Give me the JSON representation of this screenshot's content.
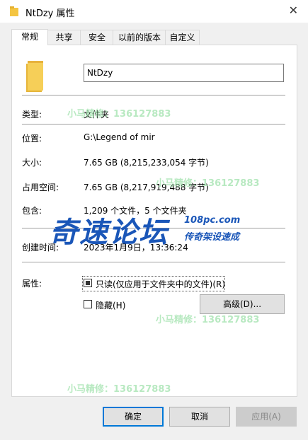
{
  "window": {
    "title": "NtDzy 属性"
  },
  "tabs": [
    {
      "label": "常规"
    },
    {
      "label": "共享"
    },
    {
      "label": "安全"
    },
    {
      "label": "以前的版本"
    },
    {
      "label": "自定义"
    }
  ],
  "general": {
    "name_value": "NtDzy",
    "type_label": "类型:",
    "type_value": "文件夹",
    "location_label": "位置:",
    "location_value": "G:\\Legend of mir",
    "size_label": "大小:",
    "size_value": "7.65 GB (8,215,233,054 字节)",
    "disk_label": "占用空间:",
    "disk_value": "7.65 GB (8,217,919,488 字节)",
    "contains_label": "包含:",
    "contains_value": "1,209 个文件，5 个文件夹",
    "created_label": "创建时间:",
    "created_value": "2023年1月9日，13:36:24",
    "attributes_label": "属性:",
    "readonly_label": "只读(仅应用于文件夹中的文件)(R)",
    "readonly_checked": true,
    "hidden_label": "隐藏(H)",
    "hidden_checked": false,
    "advanced_label": "高级(D)..."
  },
  "buttons": {
    "ok": "确定",
    "cancel": "取消",
    "apply": "应用(A)"
  },
  "watermarks": {
    "text": "小马精修：136127883",
    "logo_big": "奇速论坛",
    "logo_url": "108pc.com",
    "logo_tag": "传奇架设速成"
  },
  "colors": {
    "accent": "#0078d7",
    "folder": "#f4c542",
    "logo": "#1a56b8"
  },
  "icons": {
    "title_icon": "folder-icon",
    "close": "close-icon",
    "large_icon": "folder-icon"
  }
}
